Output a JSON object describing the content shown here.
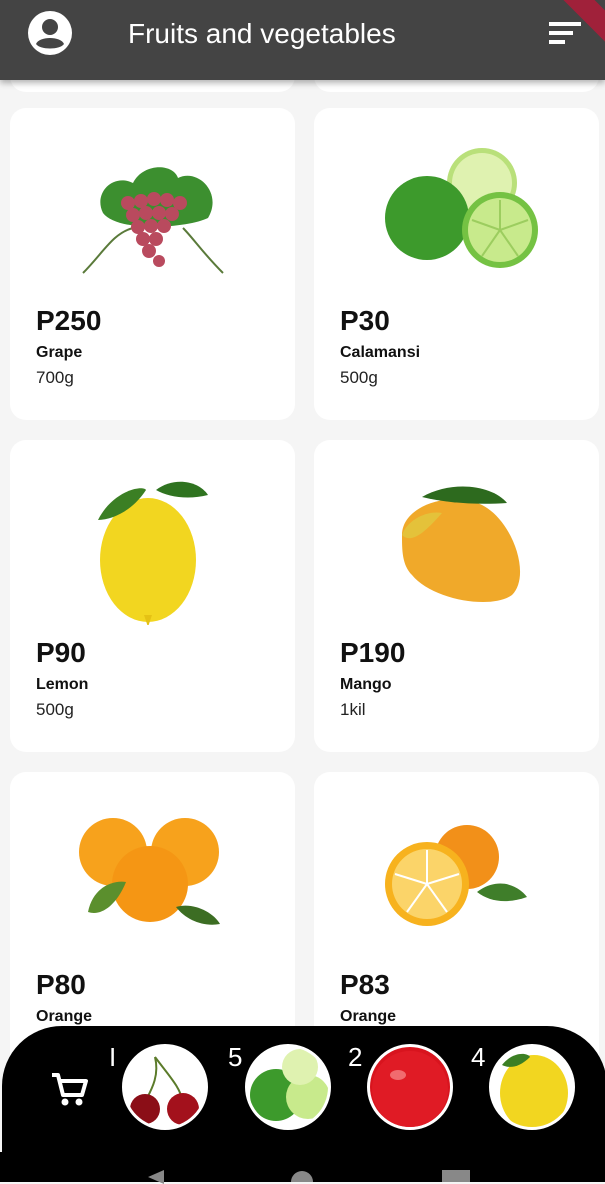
{
  "header": {
    "title": "Fruits and vegetables",
    "avatar_icon": "account-circle-icon",
    "filter_icon": "sort-icon"
  },
  "products": [
    {
      "price": "P250",
      "name": "Grape",
      "weight": "700g",
      "image": "grape"
    },
    {
      "price": "P30",
      "name": "Calamansi",
      "weight": "500g",
      "image": "calamansi"
    },
    {
      "price": "P90",
      "name": "Lemon",
      "weight": "500g",
      "image": "lemon"
    },
    {
      "price": "P190",
      "name": "Mango",
      "weight": "1kil",
      "image": "mango"
    },
    {
      "price": "P80",
      "name": "Orange",
      "weight": "",
      "image": "orange"
    },
    {
      "price": "P83",
      "name": "Orange",
      "weight": "",
      "image": "orange-slice"
    }
  ],
  "cart": {
    "icon": "shopping-cart-icon",
    "items": [
      {
        "count": "I",
        "image": "cherry"
      },
      {
        "count": "5",
        "image": "calamansi"
      },
      {
        "count": "2",
        "image": "apple"
      },
      {
        "count": "4",
        "image": "lemon"
      }
    ]
  },
  "colors": {
    "appbar": "#444444",
    "background": "#f5f5f5",
    "card": "#ffffff",
    "cart_bar": "#000000"
  }
}
